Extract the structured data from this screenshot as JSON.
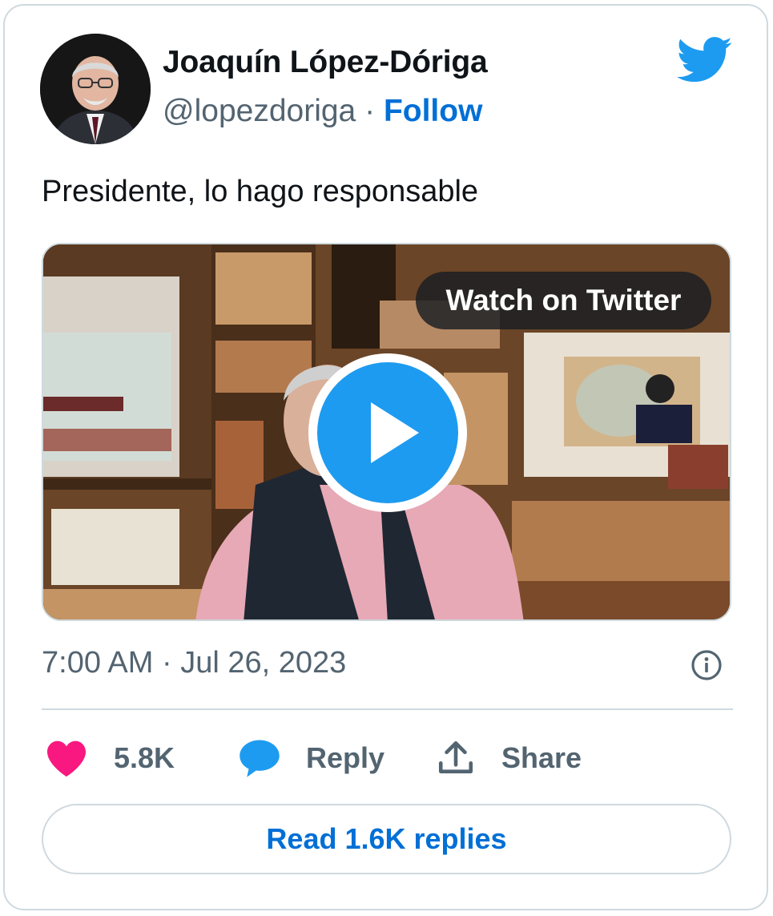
{
  "author": {
    "name": "Joaquín López-Dóriga",
    "handle": "@lopezdoriga",
    "separator": "·",
    "follow_label": "Follow"
  },
  "tweet": {
    "text": "Presidente, lo hago responsable",
    "timestamp": "7:00 AM · Jul 26, 2023"
  },
  "media": {
    "watch_label": "Watch on Twitter"
  },
  "actions": {
    "like_count": "5.8K",
    "reply_label": "Reply",
    "share_label": "Share"
  },
  "footer": {
    "read_replies_label": "Read 1.6K replies"
  },
  "icons": {
    "brand": "twitter-bird-icon",
    "play": "play-icon",
    "info": "info-icon",
    "like": "heart-icon",
    "reply": "speech-bubble-icon",
    "share": "upload-icon"
  },
  "colors": {
    "twitter_blue": "#1d9bf0",
    "link_blue": "#006fd6",
    "like_pink": "#f91880",
    "text_primary": "#0f1419",
    "text_secondary": "#536471",
    "border": "#cfd9de"
  }
}
